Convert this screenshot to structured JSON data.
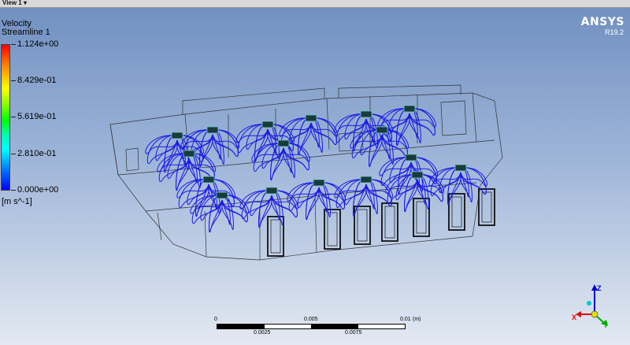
{
  "window": {
    "tab_label": "View 1 ▾"
  },
  "legend": {
    "variable": "Velocity",
    "object": "Streamline 1",
    "ticks": [
      "1.124e+00",
      "8.429e-01",
      "5.619e-01",
      "2.810e-01",
      "0.000e+00"
    ],
    "units": "[m s^-1]"
  },
  "brand": {
    "name": "ANSYS",
    "version": "R19.2"
  },
  "scale": {
    "top_labels": [
      "0",
      "0.005",
      "0.01"
    ],
    "unit": "(m)",
    "bottom_labels": [
      "0.0025",
      "0.0075"
    ]
  },
  "axes": {
    "x": "X",
    "y": "Y",
    "z": "Z"
  },
  "colors": {
    "streamline": "#1a1ae6",
    "wireframe": "#333333",
    "brand": "#ffffff"
  }
}
